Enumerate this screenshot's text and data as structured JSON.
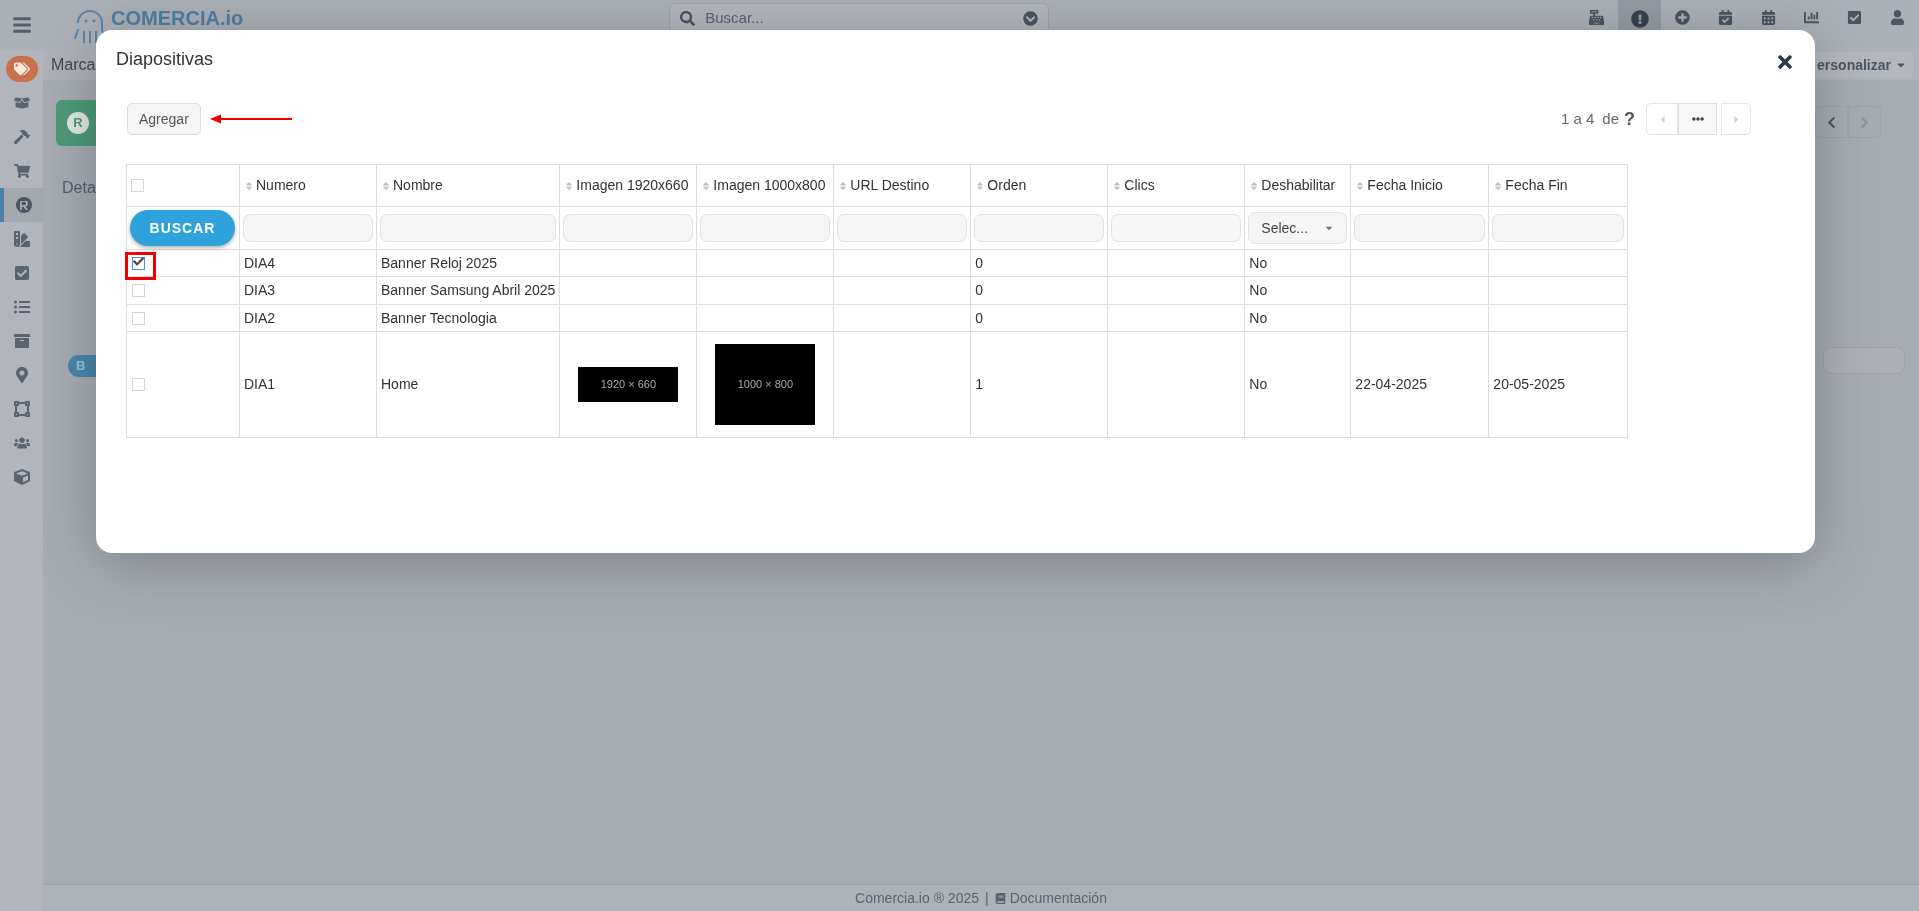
{
  "top_bar": {
    "logo": "COMERCIA.io",
    "search": {
      "placeholder": "Buscar..."
    },
    "icons": [
      {
        "kind": "register",
        "selected": false
      },
      {
        "kind": "alert",
        "selected": true
      },
      {
        "kind": "plus",
        "selected": false
      },
      {
        "kind": "calcheck",
        "selected": false
      },
      {
        "kind": "calendar",
        "selected": false
      },
      {
        "kind": "chart",
        "selected": false
      },
      {
        "kind": "task",
        "selected": false
      },
      {
        "kind": "user",
        "selected": false
      }
    ]
  },
  "sidebar": {
    "items": [
      {
        "kind": "tag",
        "selected": false
      },
      {
        "kind": "box",
        "selected": false
      },
      {
        "kind": "hammer",
        "selected": false
      },
      {
        "kind": "cart",
        "selected": false
      },
      {
        "kind": "r",
        "selected": true
      },
      {
        "kind": "swatch",
        "selected": false
      },
      {
        "kind": "task",
        "selected": false
      },
      {
        "kind": "list",
        "selected": false
      },
      {
        "kind": "cabinet",
        "selected": false
      },
      {
        "kind": "pin",
        "selected": false
      },
      {
        "kind": "vector",
        "selected": false
      },
      {
        "kind": "users",
        "selected": false
      },
      {
        "kind": "cube",
        "selected": false
      }
    ]
  },
  "page": {
    "title": "Marca",
    "customize": "ersonalizar",
    "card_letter": "R",
    "tab": "Deta",
    "button": "B"
  },
  "modal": {
    "title": "Diapositivas",
    "add_button": "Agregar",
    "pagination": {
      "range": "1 a 4",
      "of": "de",
      "total": "?"
    },
    "table": {
      "select_all": {
        "checked": false
      },
      "search_button": "BUSCAR",
      "columns": [
        "Numero",
        "Nombre",
        "Imagen 1920x660",
        "Imagen 1000x800",
        "URL Destino",
        "Orden",
        "Clics",
        "Deshabilitar",
        "Fecha Inicio",
        "Fecha Fin"
      ],
      "filters": [
        {
          "kind": "text"
        },
        {
          "kind": "text"
        },
        {
          "kind": "text"
        },
        {
          "kind": "text"
        },
        {
          "kind": "text"
        },
        {
          "kind": "text"
        },
        {
          "kind": "text"
        },
        {
          "kind": "select",
          "placeholder": "Selec..."
        },
        {
          "kind": "text"
        },
        {
          "kind": "text"
        }
      ],
      "rows": [
        {
          "checked": true,
          "cells": [
            "DIA4",
            "Banner Reloj 2025",
            null,
            null,
            null,
            "0",
            null,
            "No",
            null,
            null
          ]
        },
        {
          "checked": false,
          "cells": [
            "DIA3",
            "Banner Samsung Abril 2025",
            null,
            null,
            null,
            "0",
            null,
            "No",
            null,
            null
          ]
        },
        {
          "checked": false,
          "cells": [
            "DIA2",
            "Banner Tecnologia",
            null,
            null,
            null,
            "0",
            null,
            "No",
            null,
            null
          ]
        },
        {
          "checked": false,
          "cells": [
            "DIA1",
            "Home",
            {
              "kind": "wide",
              "label": "1920 × 660"
            },
            {
              "kind": "square",
              "label": "1000 × 800"
            },
            null,
            "1",
            null,
            "No",
            "22-04-2025",
            "20-05-2025"
          ]
        }
      ]
    }
  },
  "footer": {
    "copyright": "Comercia.io ® 2025",
    "separator": "|",
    "link": "Documentación"
  }
}
